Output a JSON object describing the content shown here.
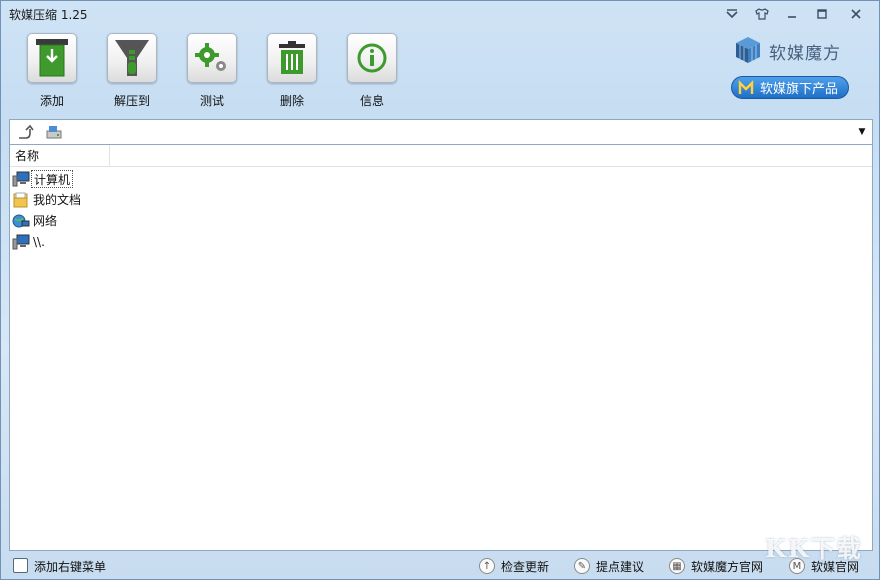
{
  "window": {
    "title": "软媒压缩 1.25"
  },
  "toolbar": {
    "buttons": [
      {
        "label": "添加",
        "icon": "add-icon"
      },
      {
        "label": "解压到",
        "icon": "zipper-icon"
      },
      {
        "label": "测试",
        "icon": "gears-icon"
      },
      {
        "label": "删除",
        "icon": "trash-icon"
      },
      {
        "label": "信息",
        "icon": "info-icon"
      }
    ]
  },
  "brand": {
    "name": "软媒魔方",
    "product_button": "软媒旗下产品"
  },
  "address": {
    "value": ""
  },
  "list": {
    "column_name": "名称",
    "items": [
      {
        "label": "计算机",
        "icon": "computer-icon",
        "selected": true
      },
      {
        "label": "我的文档",
        "icon": "documents-folder-icon",
        "selected": false
      },
      {
        "label": "网络",
        "icon": "network-icon",
        "selected": false
      },
      {
        "label": "\\\\.",
        "icon": "computer-icon",
        "selected": false
      }
    ]
  },
  "footer": {
    "context_menu_label": "添加右键菜单",
    "links": [
      {
        "label": "检查更新",
        "icon": "arrow-up-icon"
      },
      {
        "label": "提点建议",
        "icon": "pen-icon"
      },
      {
        "label": "软媒魔方官网",
        "icon": "grid-icon"
      },
      {
        "label": "软媒官网",
        "icon": "m-logo-icon"
      }
    ]
  },
  "colors": {
    "accent_green": "#3f9a2e",
    "brand_blue": "#1f6fc7",
    "window_bg": "#c6ddf2"
  },
  "watermark": "KK下载"
}
